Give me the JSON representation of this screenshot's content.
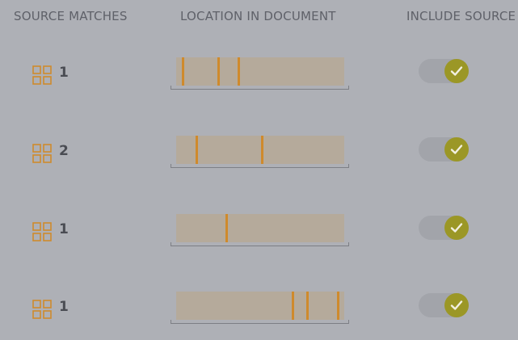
{
  "headers": {
    "source_matches": "SOURCE MATCHES",
    "location_in_document": "LOCATION IN DOCUMENT",
    "include_source": "INCLUDE SOURCE"
  },
  "rows": [
    {
      "count": "1",
      "location_markers_pct": [
        4,
        25,
        37
      ],
      "include_source": true
    },
    {
      "count": "2",
      "location_markers_pct": [
        12,
        51
      ],
      "include_source": true
    },
    {
      "count": "1",
      "location_markers_pct": [
        30
      ],
      "include_source": true
    },
    {
      "count": "1",
      "location_markers_pct": [
        69,
        78,
        96
      ],
      "include_source": true
    }
  ],
  "icons": {
    "match_icon": "grid-icon",
    "toggle_check": "checkmark-icon"
  },
  "colors": {
    "background": "#aeb0b6",
    "accent_orange": "#cf8a2c",
    "toggle_on": "#9b9726",
    "bar_fill": "#b5aa9b"
  }
}
